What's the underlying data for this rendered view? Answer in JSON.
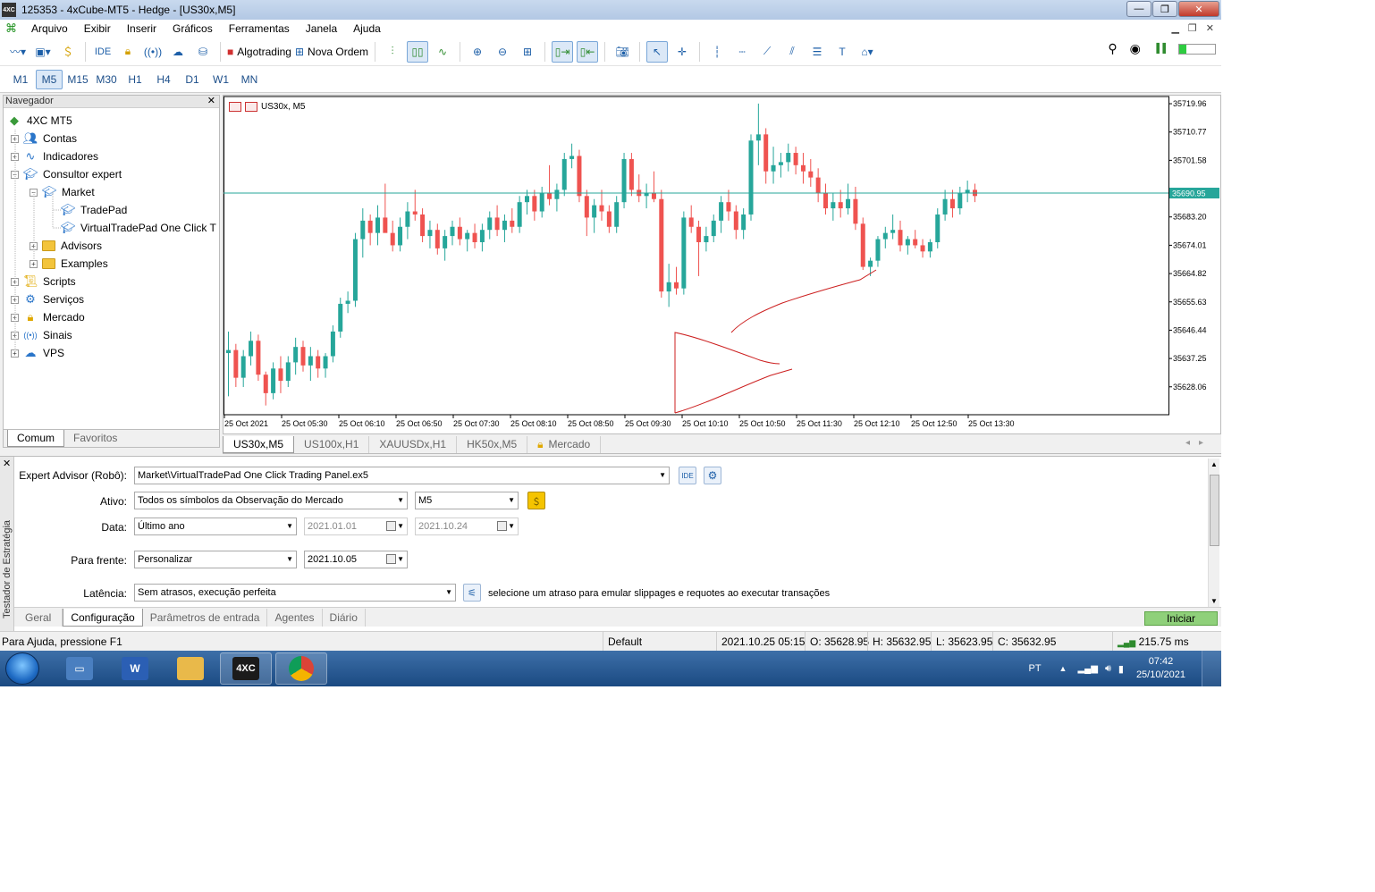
{
  "window": {
    "title": "125353 - 4xCube-MT5 - Hedge - [US30x,M5]",
    "app_badge": "4XC"
  },
  "menu": [
    "Arquivo",
    "Exibir",
    "Inserir",
    "Gráficos",
    "Ferramentas",
    "Janela",
    "Ajuda"
  ],
  "toolbar": {
    "ide": "IDE",
    "algotrading": "Algotrading",
    "new_order": "Nova Ordem"
  },
  "timeframes": [
    "M1",
    "M5",
    "M15",
    "M30",
    "H1",
    "H4",
    "D1",
    "W1",
    "MN"
  ],
  "active_timeframe": "M5",
  "navigator": {
    "title": "Navegador",
    "root": "4XC MT5",
    "items": {
      "contas": "Contas",
      "indicadores": "Indicadores",
      "consultor": "Consultor expert",
      "market": "Market",
      "tradepad": "TradePad",
      "virtualtradepad": "VirtualTradePad One Click T",
      "advisors": "Advisors",
      "examples": "Examples",
      "scripts": "Scripts",
      "servicos": "Serviços",
      "mercado": "Mercado",
      "sinais": "Sinais",
      "vps": "VPS"
    },
    "tabs": [
      "Comum",
      "Favoritos"
    ]
  },
  "chart_data": {
    "type": "candlestick",
    "symbol_label": "US30x, M5",
    "current_price": 35690.95,
    "current_price_label": "35690.95",
    "ylim": [
      35619,
      35722
    ],
    "y_ticks": [
      "35719.96",
      "35710.77",
      "35701.58",
      "35683.20",
      "35674.01",
      "35664.82",
      "35655.63",
      "35646.44",
      "35637.25",
      "35628.06"
    ],
    "x_ticks": [
      "25 Oct 2021",
      "25 Oct 05:30",
      "25 Oct 06:10",
      "25 Oct 06:50",
      "25 Oct 07:30",
      "25 Oct 08:10",
      "25 Oct 08:50",
      "25 Oct 09:30",
      "25 Oct 10:10",
      "25 Oct 10:50",
      "25 Oct 11:30",
      "25 Oct 12:10",
      "25 Oct 12:50",
      "25 Oct 13:30"
    ],
    "candles": [
      [
        35639,
        35646,
        35625,
        35640
      ],
      [
        35640,
        35642,
        35628,
        35631
      ],
      [
        35631,
        35640,
        35628,
        35638
      ],
      [
        35638,
        35646,
        35635,
        35643
      ],
      [
        35643,
        35645,
        35630,
        35632
      ],
      [
        35632,
        35633,
        35622,
        35626
      ],
      [
        35626,
        35636,
        35624,
        35634
      ],
      [
        35634,
        35638,
        35626,
        35630
      ],
      [
        35630,
        35638,
        35628,
        35636
      ],
      [
        35636,
        35644,
        35632,
        35641
      ],
      [
        35641,
        35643,
        35633,
        35635
      ],
      [
        35635,
        35641,
        35630,
        35638
      ],
      [
        35638,
        35640,
        35631,
        35634
      ],
      [
        35634,
        35639,
        35631,
        35638
      ],
      [
        35638,
        35648,
        35636,
        35646
      ],
      [
        35646,
        35657,
        35644,
        35655
      ],
      [
        35655,
        35659,
        35652,
        35656
      ],
      [
        35656,
        35678,
        35654,
        35676
      ],
      [
        35676,
        35686,
        35670,
        35682
      ],
      [
        35682,
        35684,
        35674,
        35678
      ],
      [
        35678,
        35687,
        35674,
        35683
      ],
      [
        35683,
        35694,
        35679,
        35678
      ],
      [
        35678,
        35682,
        35672,
        35674
      ],
      [
        35674,
        35683,
        35672,
        35680
      ],
      [
        35680,
        35688,
        35676,
        35685
      ],
      [
        35685,
        35692,
        35682,
        35684
      ],
      [
        35684,
        35686,
        35675,
        35677
      ],
      [
        35677,
        35682,
        35673,
        35679
      ],
      [
        35679,
        35681,
        35671,
        35673
      ],
      [
        35673,
        35679,
        35669,
        35677
      ],
      [
        35677,
        35682,
        35674,
        35680
      ],
      [
        35680,
        35683,
        35674,
        35676
      ],
      [
        35676,
        35679,
        35672,
        35678
      ],
      [
        35678,
        35681,
        35673,
        35675
      ],
      [
        35675,
        35681,
        35672,
        35679
      ],
      [
        35679,
        35685,
        35676,
        35683
      ],
      [
        35683,
        35687,
        35677,
        35679
      ],
      [
        35679,
        35684,
        35675,
        35682
      ],
      [
        35682,
        35686,
        35678,
        35680
      ],
      [
        35680,
        35690,
        35678,
        35688
      ],
      [
        35688,
        35692,
        35684,
        35690
      ],
      [
        35690,
        35692,
        35682,
        35685
      ],
      [
        35685,
        35693,
        35683,
        35691
      ],
      [
        35691,
        35700,
        35687,
        35689
      ],
      [
        35689,
        35694,
        35685,
        35692
      ],
      [
        35692,
        35704,
        35690,
        35702
      ],
      [
        35702,
        35707,
        35699,
        35703
      ],
      [
        35703,
        35705,
        35688,
        35690
      ],
      [
        35690,
        35692,
        35677,
        35683
      ],
      [
        35683,
        35689,
        35678,
        35687
      ],
      [
        35687,
        35692,
        35682,
        35685
      ],
      [
        35685,
        35687,
        35678,
        35680
      ],
      [
        35680,
        35690,
        35678,
        35688
      ],
      [
        35688,
        35704,
        35686,
        35702
      ],
      [
        35702,
        35704,
        35690,
        35692
      ],
      [
        35692,
        35697,
        35688,
        35690
      ],
      [
        35690,
        35694,
        35686,
        35691
      ],
      [
        35691,
        35698,
        35688,
        35689
      ],
      [
        35689,
        35692,
        35657,
        35659
      ],
      [
        35659,
        35668,
        35654,
        35662
      ],
      [
        35662,
        35667,
        35658,
        35660
      ],
      [
        35660,
        35685,
        35658,
        35683
      ],
      [
        35683,
        35687,
        35678,
        35680
      ],
      [
        35680,
        35682,
        35664,
        35675
      ],
      [
        35675,
        35680,
        35672,
        35677
      ],
      [
        35677,
        35684,
        35675,
        35682
      ],
      [
        35682,
        35690,
        35678,
        35688
      ],
      [
        35688,
        35692,
        35682,
        35685
      ],
      [
        35685,
        35687,
        35676,
        35679
      ],
      [
        35679,
        35686,
        35676,
        35684
      ],
      [
        35684,
        35710,
        35682,
        35708
      ],
      [
        35708,
        35720,
        35700,
        35710
      ],
      [
        35710,
        35712,
        35694,
        35698
      ],
      [
        35698,
        35706,
        35694,
        35700
      ],
      [
        35700,
        35704,
        35696,
        35701
      ],
      [
        35701,
        35707,
        35698,
        35704
      ],
      [
        35704,
        35706,
        35697,
        35700
      ],
      [
        35700,
        35704,
        35694,
        35698
      ],
      [
        35698,
        35702,
        35693,
        35696
      ],
      [
        35696,
        35699,
        35688,
        35691
      ],
      [
        35691,
        35694,
        35684,
        35686
      ],
      [
        35686,
        35691,
        35682,
        35688
      ],
      [
        35688,
        35692,
        35683,
        35686
      ],
      [
        35686,
        35694,
        35684,
        35689
      ],
      [
        35689,
        35693,
        35679,
        35681
      ],
      [
        35681,
        35683,
        35666,
        35667
      ],
      [
        35667,
        35670,
        35664,
        35669
      ],
      [
        35669,
        35677,
        35667,
        35676
      ],
      [
        35676,
        35680,
        35673,
        35678
      ],
      [
        35678,
        35684,
        35676,
        35679
      ],
      [
        35679,
        35682,
        35672,
        35674
      ],
      [
        35674,
        35677,
        35671,
        35676
      ],
      [
        35676,
        35679,
        35673,
        35674
      ],
      [
        35674,
        35676,
        35670,
        35672
      ],
      [
        35672,
        35676,
        35670,
        35675
      ],
      [
        35675,
        35686,
        35673,
        35684
      ],
      [
        35684,
        35692,
        35682,
        35689
      ],
      [
        35689,
        35692,
        35683,
        35686
      ],
      [
        35686,
        35693,
        35684,
        35691
      ],
      [
        35691,
        35695,
        35688,
        35692
      ],
      [
        35692,
        35694,
        35688,
        35690
      ]
    ],
    "grid": false
  },
  "chart_tabs": [
    "US30x,M5",
    "US100x,H1",
    "XAUUSDx,H1",
    "HK50x,M5",
    "Mercado"
  ],
  "tester": {
    "side_title": "Testador de Estratégia",
    "ea_label": "Expert Advisor (Robô):",
    "ea_value": "Market\\VirtualTradePad One Click Trading Panel.ex5",
    "asset_label": "Ativo:",
    "asset_value": "Todos os símbolos da Observação do Mercado",
    "period_value": "M5",
    "date_label": "Data:",
    "date_mode": "Último ano",
    "date_from": "2021.01.01",
    "date_to": "2021.10.24",
    "forward_label": "Para frente:",
    "forward_mode": "Personalizar",
    "forward_date": "2021.10.05",
    "latency_label": "Latência:",
    "latency_value": "Sem atrasos, execução perfeita",
    "latency_hint": "selecione um atraso para emular slippages e requotes ao executar transações",
    "ide": "IDE",
    "tabs": [
      "Geral",
      "Configuração",
      "Parâmetros de entrada",
      "Agentes",
      "Diário"
    ],
    "start_button": "Iniciar"
  },
  "status": {
    "help": "Para Ajuda, pressione F1",
    "profile": "Default",
    "datetime": "2021.10.25 05:15",
    "open": "O: 35628.95",
    "high": "H: 35632.95",
    "low": "L: 35623.95",
    "close": "C: 35632.95",
    "ping": "215.75 ms"
  },
  "taskbar": {
    "app_4xc": "4XC",
    "lang": "PT",
    "time": "07:42",
    "date": "25/10/2021"
  },
  "colors": {
    "bull": "#26a69a",
    "bear": "#ef5350",
    "price_line": "#26a69a",
    "accent": "#1d5fa8"
  }
}
